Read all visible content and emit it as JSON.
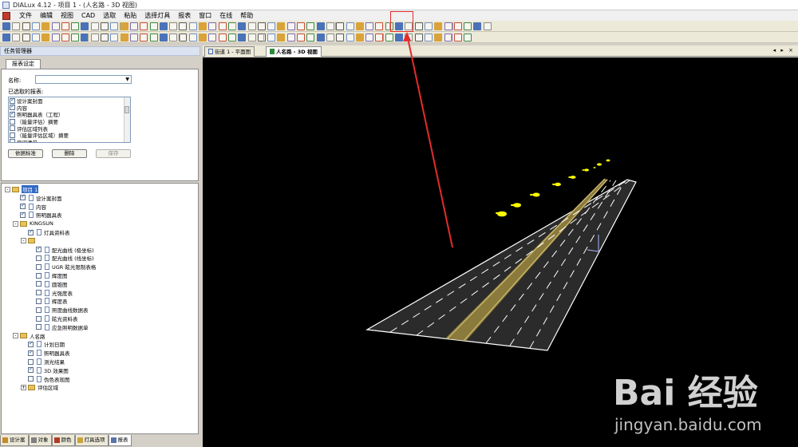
{
  "window": {
    "title": "DIALux 4.12 - 项目 1 - (人名路 - 3D 视图)"
  },
  "menu": [
    "文件",
    "编辑",
    "视图",
    "CAD",
    "选取",
    "粘贴",
    "选择灯具",
    "报表",
    "窗口",
    "在线",
    "帮助"
  ],
  "left_panel": {
    "title": "任务管理器",
    "tab": "报表设定",
    "name_label": "名称:",
    "name_value": "",
    "selected_label": "已选取的报表:",
    "reports": [
      {
        "label": "设计案封面",
        "checked": true
      },
      {
        "label": "内容",
        "checked": true
      },
      {
        "label": "照明器具表（工程）",
        "checked": true
      },
      {
        "label": "（能量评估）摘要",
        "checked": false
      },
      {
        "label": "评估区域列表",
        "checked": false
      },
      {
        "label": "（能量评估区域）摘要",
        "checked": false
      },
      {
        "label": "房间清单",
        "checked": false
      }
    ],
    "buttons": {
      "default": "依据标准",
      "delete": "删除",
      "save": "保存"
    }
  },
  "tree": {
    "nodes": [
      {
        "label": "项目 1",
        "level": 0,
        "type": "root",
        "expand": "-",
        "selected": true
      },
      {
        "label": "设计案封面",
        "level": 1,
        "type": "page",
        "checked": true
      },
      {
        "label": "内容",
        "level": 1,
        "type": "page",
        "checked": true
      },
      {
        "label": "照明器具表",
        "level": 1,
        "type": "page",
        "checked": true
      },
      {
        "label": "KINGSUN",
        "level": 1,
        "type": "folder",
        "expand": "-"
      },
      {
        "label": "灯具资料表",
        "level": 2,
        "type": "page",
        "checked": true
      },
      {
        "label": "",
        "level": 2,
        "type": "folder",
        "expand": "-"
      },
      {
        "label": "配光曲线 (极坐标)",
        "level": 3,
        "type": "page",
        "checked": true
      },
      {
        "label": "配光曲线 (线坐标)",
        "level": 3,
        "type": "page",
        "checked": false
      },
      {
        "label": "UGR 眩光限制表格",
        "level": 3,
        "type": "page",
        "checked": false
      },
      {
        "label": "辉度图",
        "level": 3,
        "type": "page",
        "checked": false
      },
      {
        "label": "圆锥图",
        "level": 3,
        "type": "page",
        "checked": false
      },
      {
        "label": "光强度表",
        "level": 3,
        "type": "page",
        "checked": false
      },
      {
        "label": "辉度表",
        "level": 3,
        "type": "page",
        "checked": false
      },
      {
        "label": "照度曲线数据表",
        "level": 3,
        "type": "page",
        "checked": false
      },
      {
        "label": "眩光资料表",
        "level": 3,
        "type": "page",
        "checked": false
      },
      {
        "label": "应急照明数据单",
        "level": 3,
        "type": "page",
        "checked": false
      },
      {
        "label": "人名路",
        "level": 1,
        "type": "folder",
        "expand": "-"
      },
      {
        "label": "计划日期",
        "level": 2,
        "type": "page",
        "checked": true
      },
      {
        "label": "照明器具表",
        "level": 2,
        "type": "page",
        "checked": true
      },
      {
        "label": "测光结果",
        "level": 2,
        "type": "page",
        "checked": false
      },
      {
        "label": "3D 效果图",
        "level": 2,
        "type": "page",
        "checked": true
      },
      {
        "label": "伪色表现图",
        "level": 2,
        "type": "page",
        "checked": false
      },
      {
        "label": "评估区域",
        "level": 2,
        "type": "folder",
        "expand": "+"
      }
    ]
  },
  "bottom_tabs": [
    {
      "label": "设计案",
      "color": "#c8892a"
    },
    {
      "label": "对象",
      "color": "#7f7f7f"
    },
    {
      "label": "颜色",
      "color": "#b33a2a"
    },
    {
      "label": "灯具选项",
      "color": "#caa33a"
    },
    {
      "label": "报表",
      "color": "#5a72a8",
      "active": true
    }
  ],
  "doc_tabs": [
    {
      "label": "街道 1 - 平面图",
      "active": false,
      "color": "#3f66a8"
    },
    {
      "label": "人名路 - 3D 视图",
      "active": true,
      "color": "#2d8a3a"
    }
  ],
  "tab_nav": "◂ ▸ ×",
  "watermark": {
    "logo": "Bai 经验",
    "url": "jingyan.baidu.com"
  },
  "colors": {
    "accent_red": "#e52b2b",
    "road": "#2b2b2b",
    "road_edge": "#ffffff",
    "lamp": "#ffff00",
    "center_line": "#b89b4a"
  }
}
